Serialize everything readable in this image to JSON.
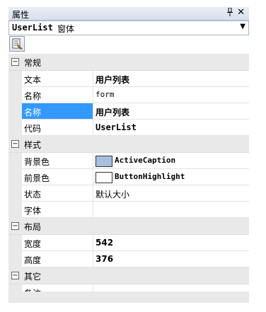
{
  "panel": {
    "title": "属性"
  },
  "object_selector": {
    "name": "UserList",
    "type": "窗体"
  },
  "grid": {
    "categories": [
      {
        "label": "常规",
        "rows": [
          {
            "name": "文本",
            "value": "用户列表",
            "style": "bold"
          },
          {
            "name": "名称",
            "value": "form",
            "style": "mono-small"
          },
          {
            "name": "名称",
            "value": "用户列表",
            "style": "bold",
            "selected": true
          },
          {
            "name": "代码",
            "value": "UserList",
            "style": "bold-mono"
          }
        ]
      },
      {
        "label": "样式",
        "rows": [
          {
            "name": "背景色",
            "value": "ActiveCaption",
            "swatch": "#a6bfde"
          },
          {
            "name": "前景色",
            "value": "ButtonHighlight",
            "swatch": "#ffffff"
          },
          {
            "name": "状态",
            "value": "默认大小",
            "style": "normal"
          },
          {
            "name": "字体",
            "value": "",
            "style": "normal"
          }
        ]
      },
      {
        "label": "布局",
        "rows": [
          {
            "name": "宽度",
            "value": "542",
            "style": "bold"
          },
          {
            "name": "高度",
            "value": "376",
            "style": "bold"
          }
        ]
      },
      {
        "label": "其它",
        "rows": [
          {
            "name": "备注",
            "value": "",
            "style": "normal"
          }
        ]
      }
    ]
  },
  "colors": {
    "selection": "#3399ff",
    "category_bg": "#e9e9e9"
  },
  "icons": {
    "pin": "pin-icon",
    "close": "close-icon",
    "dropdown": "dropdown-arrow-icon",
    "property_pages": "property-pages-icon",
    "collapse": "collapse-icon"
  }
}
